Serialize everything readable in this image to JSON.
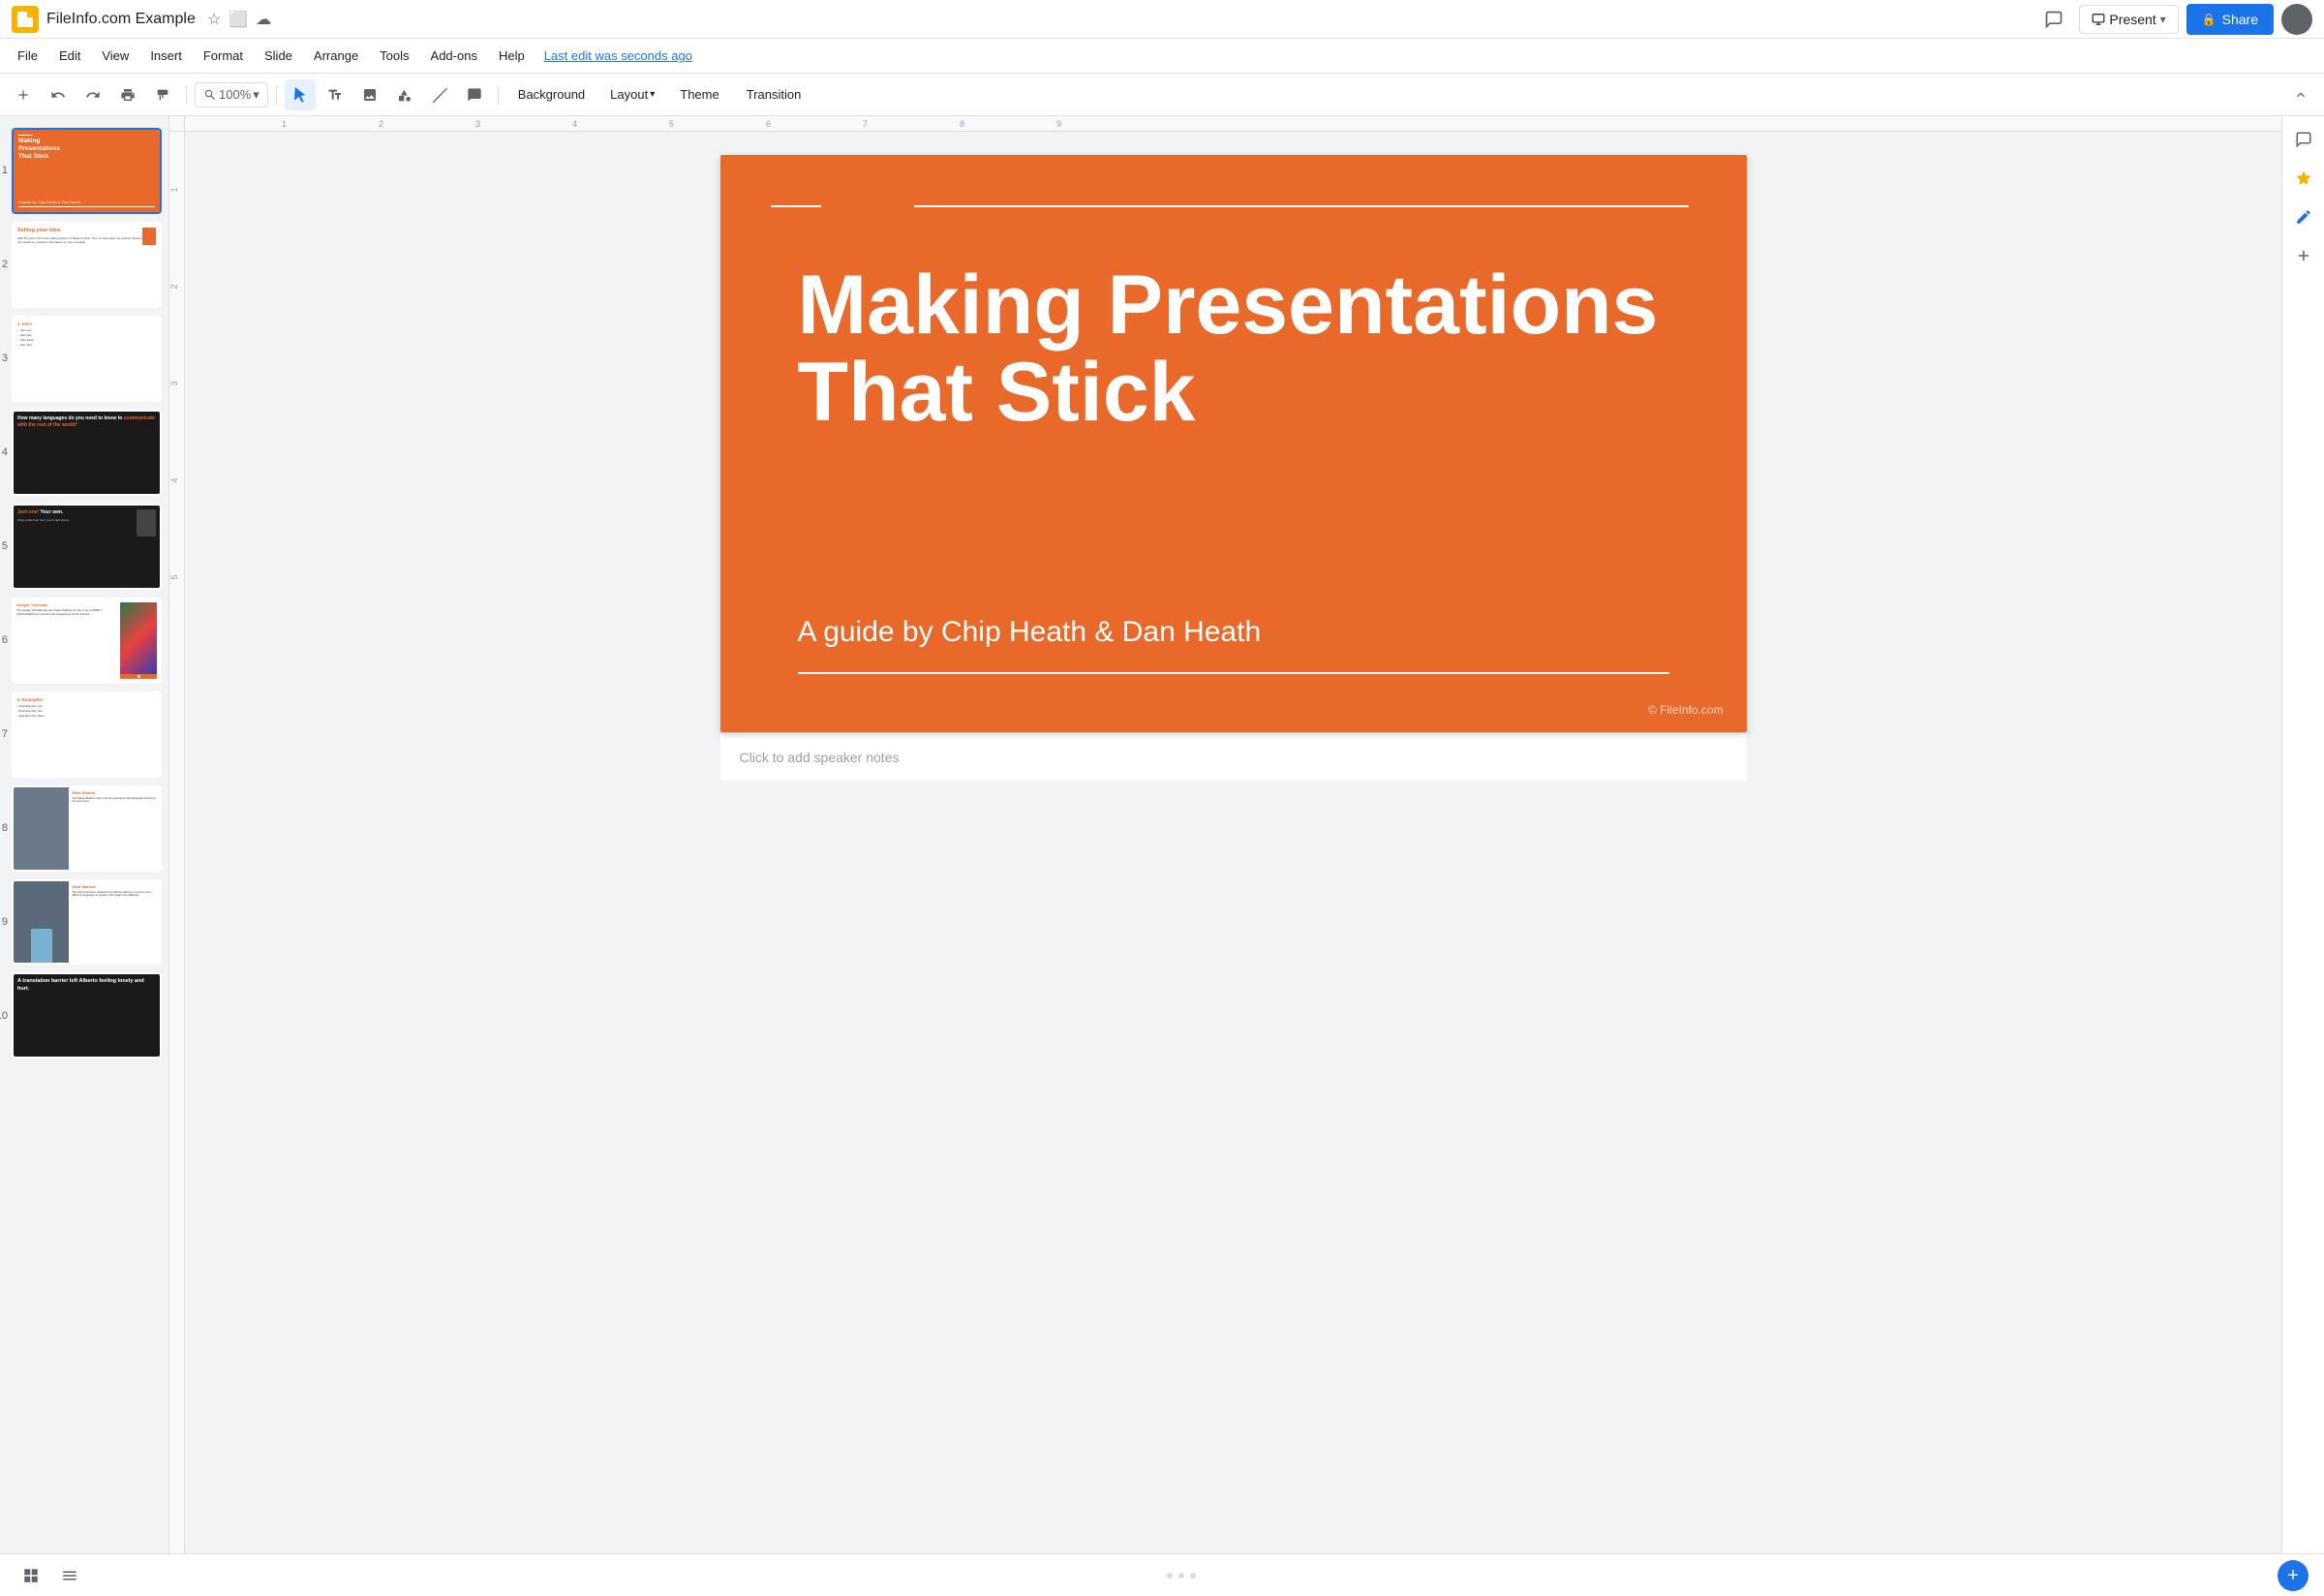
{
  "app": {
    "title": "FileInfo.com Example",
    "icon": "★",
    "cloud_icon": "☁",
    "last_edit": "Last edit was seconds ago"
  },
  "header": {
    "present_label": "Present",
    "share_label": "Share",
    "comment_icon": "💬"
  },
  "menu": {
    "items": [
      "File",
      "Edit",
      "View",
      "Insert",
      "Format",
      "Slide",
      "Arrange",
      "Tools",
      "Add-ons",
      "Help"
    ]
  },
  "toolbar": {
    "zoom_level": "100%",
    "background_label": "Background",
    "layout_label": "Layout",
    "theme_label": "Theme",
    "transition_label": "Transition"
  },
  "slides": [
    {
      "number": 1,
      "title": "Making Presentations That Stick",
      "subtitle": "A guide by Chip Heath & Dan Heath",
      "type": "title"
    },
    {
      "number": 2,
      "title": "Selling your idea",
      "type": "content"
    },
    {
      "number": 3,
      "title": "1. Intro",
      "type": "outline"
    },
    {
      "number": 4,
      "title": "How many languages do you need to know to communicate with the rest of the world?",
      "type": "dark-question"
    },
    {
      "number": 5,
      "title": "Just one! Your own.",
      "type": "dark-answer"
    },
    {
      "number": 6,
      "title": "The Google Translate app can repair anything you say in up to NINETY LANGUAGES from German and Japanese to Czech and Zulu.",
      "type": "photo-content"
    },
    {
      "number": 7,
      "title": "2. Examples",
      "type": "outline"
    },
    {
      "number": 8,
      "title": "Meet Alberto",
      "type": "photo-person"
    },
    {
      "number": 9,
      "title": "Meet Marcus",
      "type": "photo-person-2"
    },
    {
      "number": 10,
      "title": "A translation barrier left Alberto feeling lonely and hurt.",
      "type": "dark-closing"
    }
  ],
  "main_slide": {
    "title": "Making Presentations That Stick",
    "subtitle": "A guide by Chip Heath & Dan Heath",
    "copyright": "© FileInfo.com"
  },
  "speaker_notes": {
    "placeholder": "Click to add speaker notes"
  },
  "right_panel": {
    "icons": [
      "💬",
      "🔆",
      "✏️",
      "+"
    ]
  },
  "colors": {
    "orange": "#e8692a",
    "dark": "#1a1a1a",
    "blue": "#1a73e8",
    "white": "#ffffff"
  }
}
